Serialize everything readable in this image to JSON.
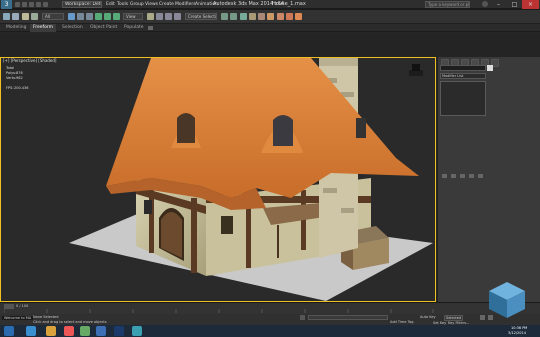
{
  "app": {
    "title": "Autodesk 3ds Max  2014 x64",
    "file": "House_1.max",
    "workspace": "Workspace: Default",
    "search_placeholder": "Type a keyword or phrase"
  },
  "menus": [
    "Edit",
    "Tools",
    "Group",
    "Views",
    "Create",
    "Modifiers",
    "Animation",
    "Graph Editors",
    "Rendering",
    "Customize",
    "MAXScript",
    "Help"
  ],
  "toolbar": {
    "selection_filter": "All",
    "reference_coord": "View",
    "named_set": "Create Selection Se"
  },
  "ribbon_tabs": [
    "Modeling",
    "Freeform",
    "Selection",
    "Object Paint",
    "Populate"
  ],
  "viewport": {
    "label": "[+] [Perspective] [Shaded]",
    "stats": {
      "total_label": "Total",
      "polys_label": "Polys:",
      "polys_value": "876",
      "verts_label": "Verts:",
      "verts_value": "962",
      "fps_label": "FPS:",
      "fps_value": "200.436"
    }
  },
  "command_panel": {
    "modifier_list": "Modifier List"
  },
  "timeline": {
    "frame": "0 / 100"
  },
  "status": {
    "selected": "None Selected",
    "prompt": "Click and drag to select and move objects",
    "welcome": "Welcome to MA",
    "add_time_tag": "Add Time Tag",
    "auto_key": "Auto Key",
    "set_key": "Set Key",
    "selected_dd": "Selected",
    "key_filters": "Key Filters..."
  },
  "taskbar": {
    "clock_time": "10:36 PM",
    "clock_date": "3/12/2014"
  },
  "colors": {
    "roof": "#d9803a",
    "viewport_frame": "#f0c020",
    "background": "#2a2a2a"
  }
}
